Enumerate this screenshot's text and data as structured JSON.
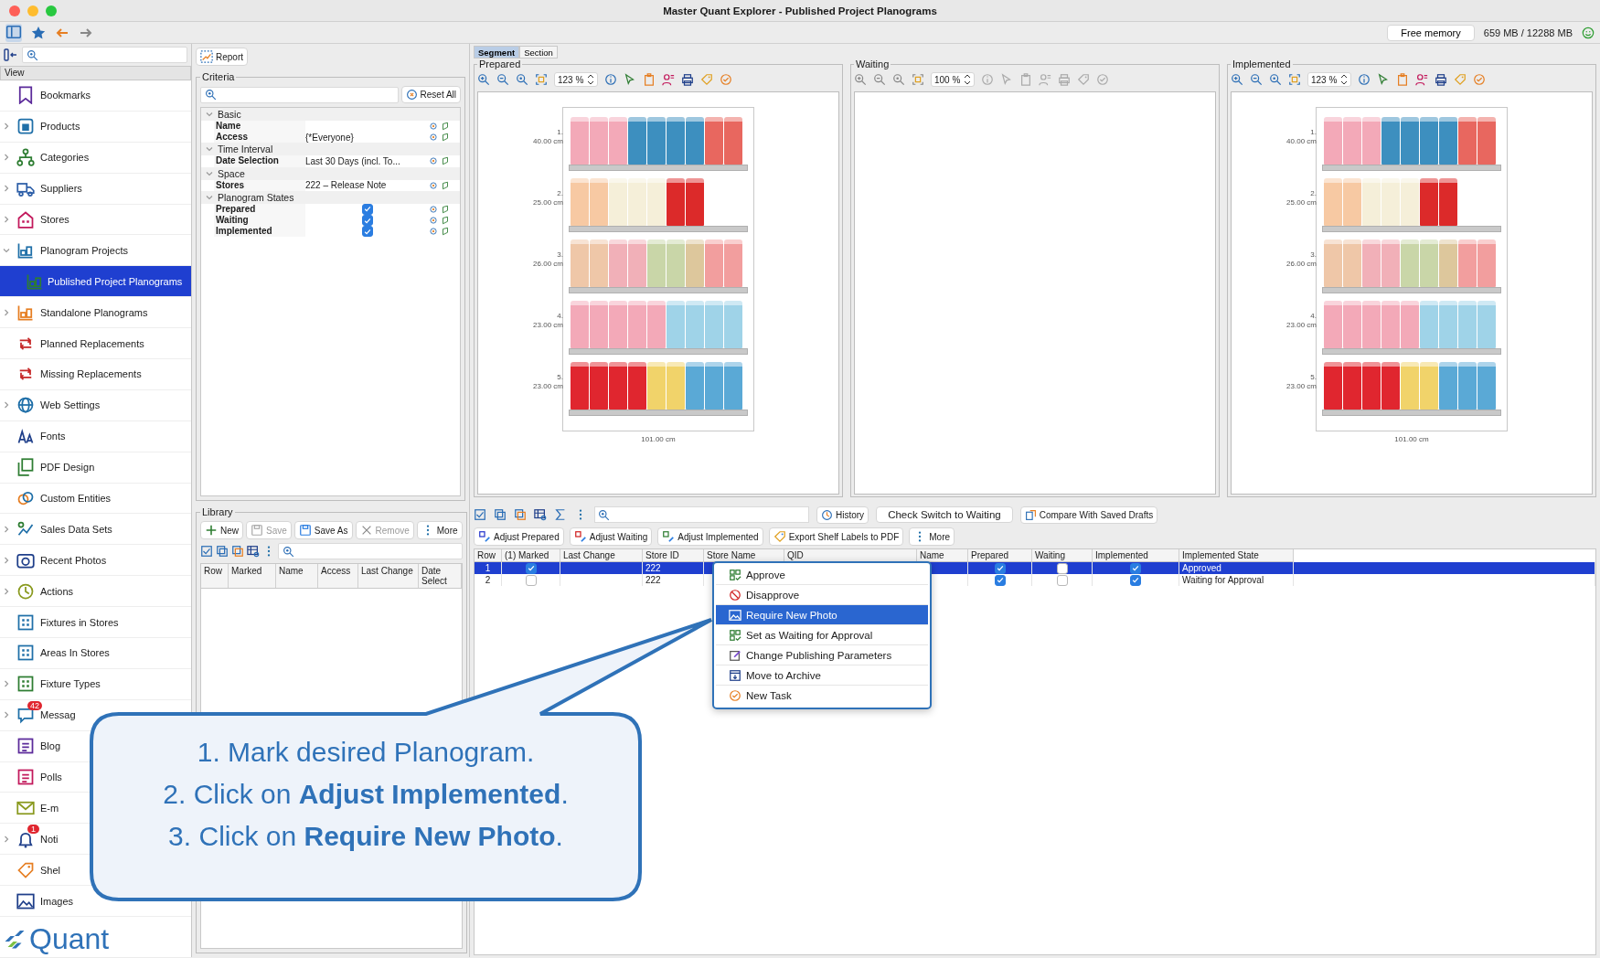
{
  "window": {
    "title": "Master Quant Explorer - Published Project Planograms"
  },
  "toolbar": {
    "free_memory_button": "Free memory",
    "memory_reading": "659 MB / 12288 MB"
  },
  "sidebar": {
    "header": "View",
    "logo": "Quant",
    "items": [
      {
        "label": "Bookmarks",
        "kind": "bookmarks",
        "expandable": false,
        "selected": false
      },
      {
        "label": "Products",
        "kind": "products",
        "expandable": true,
        "expanded": false,
        "selected": false
      },
      {
        "label": "Categories",
        "kind": "categories",
        "expandable": true,
        "expanded": false,
        "selected": false
      },
      {
        "label": "Suppliers",
        "kind": "suppliers",
        "expandable": true,
        "expanded": false,
        "selected": false
      },
      {
        "label": "Stores",
        "kind": "stores",
        "expandable": true,
        "expanded": false,
        "selected": false
      },
      {
        "label": "Planogram Projects",
        "kind": "planogram_projects",
        "expandable": true,
        "expanded": true,
        "selected": false,
        "children": [
          {
            "label": "Published Project Planograms",
            "kind": "published",
            "expandable": false,
            "selected": true
          }
        ]
      },
      {
        "label": "Standalone Planograms",
        "kind": "standalone",
        "expandable": true,
        "expanded": false,
        "selected": false
      },
      {
        "label": "Planned Replacements",
        "kind": "planned_replacements",
        "expandable": false,
        "selected": false
      },
      {
        "label": "Missing Replacements",
        "kind": "missing_replacements",
        "expandable": false,
        "selected": false
      },
      {
        "label": "Web Settings",
        "kind": "web_settings",
        "expandable": true,
        "expanded": false,
        "selected": false
      },
      {
        "label": "Fonts",
        "kind": "fonts",
        "expandable": false,
        "selected": false
      },
      {
        "label": "PDF Design",
        "kind": "pdf_design",
        "expandable": false,
        "selected": false
      },
      {
        "label": "Custom Entities",
        "kind": "custom_entities",
        "expandable": false,
        "selected": false
      },
      {
        "label": "Sales Data Sets",
        "kind": "sales_data_sets",
        "expandable": true,
        "expanded": false,
        "selected": false
      },
      {
        "label": "Recent Photos",
        "kind": "recent_photos",
        "expandable": true,
        "expanded": false,
        "selected": false
      },
      {
        "label": "Actions",
        "kind": "actions",
        "expandable": true,
        "expanded": false,
        "selected": false
      },
      {
        "label": "Fixtures in Stores",
        "kind": "fixtures",
        "expandable": false,
        "selected": false
      },
      {
        "label": "Areas In Stores",
        "kind": "areas",
        "expandable": false,
        "selected": false
      },
      {
        "label": "Fixture Types",
        "kind": "fixture_types",
        "expandable": true,
        "expanded": false,
        "selected": false
      },
      {
        "label": "Messag",
        "kind": "messages",
        "expandable": true,
        "expanded": false,
        "selected": false,
        "badge": "42"
      },
      {
        "label": "Blog",
        "kind": "blog",
        "expandable": false,
        "selected": false
      },
      {
        "label": "Polls",
        "kind": "polls",
        "expandable": false,
        "selected": false
      },
      {
        "label": "E-m",
        "kind": "email",
        "expandable": false,
        "selected": false
      },
      {
        "label": "Noti",
        "kind": "notifications",
        "expandable": true,
        "expanded": false,
        "selected": false,
        "badge": "1"
      },
      {
        "label": "Shel",
        "kind": "shelf_labels",
        "expandable": false,
        "selected": false
      },
      {
        "label": "Images",
        "kind": "images",
        "expandable": false,
        "selected": false
      }
    ]
  },
  "report_button": "Report",
  "criteria": {
    "title": "Criteria",
    "reset_button": "Reset All",
    "groups": [
      {
        "label": "Basic",
        "expanded": true,
        "rows": [
          {
            "label": "Name",
            "kind": "text"
          },
          {
            "label": "Access",
            "kind": "text",
            "value": "{*Everyone}"
          }
        ]
      },
      {
        "label": "Time Interval",
        "expanded": true,
        "rows": [
          {
            "label": "Date Selection",
            "kind": "text",
            "value": "Last 30 Days (incl. To..."
          }
        ]
      },
      {
        "label": "Space",
        "expanded": true,
        "rows": [
          {
            "label": "Stores",
            "kind": "text",
            "value": "222 – Release Note"
          }
        ]
      },
      {
        "label": "Planogram States",
        "expanded": true,
        "rows": [
          {
            "label": "Prepared",
            "kind": "checkbox",
            "checked": true
          },
          {
            "label": "Waiting",
            "kind": "checkbox",
            "checked": true
          },
          {
            "label": "Implemented",
            "kind": "checkbox",
            "checked": true
          }
        ]
      }
    ]
  },
  "library": {
    "title": "Library",
    "buttons": [
      {
        "label": "New",
        "kind": "plus",
        "disabled": false
      },
      {
        "label": "Save",
        "kind": "save",
        "disabled": true
      },
      {
        "label": "Save As",
        "kind": "save",
        "disabled": false
      },
      {
        "label": "Remove",
        "kind": "cross",
        "disabled": true
      },
      {
        "label": "More",
        "kind": "dots",
        "disabled": false
      }
    ],
    "columns": [
      "Row",
      "Marked",
      "Name",
      "Access",
      "Last Change",
      "Date Select"
    ]
  },
  "views": {
    "tabs": [
      {
        "label": "Segment",
        "selected": true
      },
      {
        "label": "Section",
        "selected": false
      }
    ],
    "panels": [
      {
        "title": "Prepared",
        "zoom": "123 %",
        "tools_enabled": true,
        "width_label": "101.00 cm",
        "shelves": [
          {
            "number": "1.",
            "height": "40.00 cm",
            "products": [
              {
                "color": "#f3a9b8"
              },
              {
                "color": "#f3a9b8"
              },
              {
                "color": "#f3a9b8"
              },
              {
                "color": "#3d8fbf"
              },
              {
                "color": "#3d8fbf"
              },
              {
                "color": "#3d8fbf"
              },
              {
                "color": "#3d8fbf"
              },
              {
                "color": "#e8675f"
              },
              {
                "color": "#e8675f"
              }
            ]
          },
          {
            "number": "2.",
            "height": "25.00 cm",
            "products": [
              {
                "color": "#f7c9a3"
              },
              {
                "color": "#f7c9a3"
              },
              {
                "color": "#f5efd9"
              },
              {
                "color": "#f5efd9"
              },
              {
                "color": "#f5efd9"
              },
              {
                "color": "#dc2a2a"
              },
              {
                "color": "#dc2a2a"
              }
            ]
          },
          {
            "number": "3.",
            "height": "26.00 cm",
            "products": [
              {
                "color": "#efc7a8"
              },
              {
                "color": "#efc7a8"
              },
              {
                "color": "#f1b0b8"
              },
              {
                "color": "#f1b0b8"
              },
              {
                "color": "#c9d6a8"
              },
              {
                "color": "#c9d6a8"
              },
              {
                "color": "#ddc79c"
              },
              {
                "color": "#f29e9e"
              },
              {
                "color": "#f29e9e"
              }
            ]
          },
          {
            "number": "4.",
            "height": "23.00 cm",
            "products": [
              {
                "color": "#f3a9b8"
              },
              {
                "color": "#f3a9b8"
              },
              {
                "color": "#f3a9b8"
              },
              {
                "color": "#f3a9b8"
              },
              {
                "color": "#f3a9b8"
              },
              {
                "color": "#9fd3e8"
              },
              {
                "color": "#9fd3e8"
              },
              {
                "color": "#9fd3e8"
              },
              {
                "color": "#9fd3e8"
              }
            ]
          },
          {
            "number": "5.",
            "height": "23.00 cm",
            "products": [
              {
                "color": "#e0262f"
              },
              {
                "color": "#e0262f"
              },
              {
                "color": "#e0262f"
              },
              {
                "color": "#e0262f"
              },
              {
                "color": "#f1d36a"
              },
              {
                "color": "#f1d36a"
              },
              {
                "color": "#5aa9d6"
              },
              {
                "color": "#5aa9d6"
              },
              {
                "color": "#5aa9d6"
              }
            ]
          }
        ]
      },
      {
        "title": "Waiting",
        "zoom": "100 %",
        "tools_enabled": false
      },
      {
        "title": "Implemented",
        "zoom": "123 %",
        "tools_enabled": true,
        "width_label": "101.00 cm",
        "shelves": [
          {
            "number": "1.",
            "height": "40.00 cm",
            "products": [
              {
                "color": "#f3a9b8"
              },
              {
                "color": "#f3a9b8"
              },
              {
                "color": "#f3a9b8"
              },
              {
                "color": "#3d8fbf"
              },
              {
                "color": "#3d8fbf"
              },
              {
                "color": "#3d8fbf"
              },
              {
                "color": "#3d8fbf"
              },
              {
                "color": "#e8675f"
              },
              {
                "color": "#e8675f"
              }
            ]
          },
          {
            "number": "2.",
            "height": "25.00 cm",
            "products": [
              {
                "color": "#f7c9a3"
              },
              {
                "color": "#f7c9a3"
              },
              {
                "color": "#f5efd9"
              },
              {
                "color": "#f5efd9"
              },
              {
                "color": "#f5efd9"
              },
              {
                "color": "#dc2a2a"
              },
              {
                "color": "#dc2a2a"
              }
            ]
          },
          {
            "number": "3.",
            "height": "26.00 cm",
            "products": [
              {
                "color": "#efc7a8"
              },
              {
                "color": "#efc7a8"
              },
              {
                "color": "#f1b0b8"
              },
              {
                "color": "#f1b0b8"
              },
              {
                "color": "#c9d6a8"
              },
              {
                "color": "#c9d6a8"
              },
              {
                "color": "#ddc79c"
              },
              {
                "color": "#f29e9e"
              },
              {
                "color": "#f29e9e"
              }
            ]
          },
          {
            "number": "4.",
            "height": "23.00 cm",
            "products": [
              {
                "color": "#f3a9b8"
              },
              {
                "color": "#f3a9b8"
              },
              {
                "color": "#f3a9b8"
              },
              {
                "color": "#f3a9b8"
              },
              {
                "color": "#f3a9b8"
              },
              {
                "color": "#9fd3e8"
              },
              {
                "color": "#9fd3e8"
              },
              {
                "color": "#9fd3e8"
              },
              {
                "color": "#9fd3e8"
              }
            ]
          },
          {
            "number": "5.",
            "height": "23.00 cm",
            "products": [
              {
                "color": "#e0262f"
              },
              {
                "color": "#e0262f"
              },
              {
                "color": "#e0262f"
              },
              {
                "color": "#e0262f"
              },
              {
                "color": "#f1d36a"
              },
              {
                "color": "#f1d36a"
              },
              {
                "color": "#5aa9d6"
              },
              {
                "color": "#5aa9d6"
              },
              {
                "color": "#5aa9d6"
              }
            ]
          }
        ]
      }
    ]
  },
  "results": {
    "history_button": "History",
    "check_button": "Check Switch to Waiting",
    "compare_button": "Compare With Saved Drafts",
    "actions": [
      {
        "label": "Adjust Prepared",
        "kind": "adjust_blue"
      },
      {
        "label": "Adjust Waiting",
        "kind": "adjust_red"
      },
      {
        "label": "Adjust Implemented",
        "kind": "adjust_green"
      },
      {
        "label": "Export Shelf Labels to PDF",
        "kind": "label"
      },
      {
        "label": "More",
        "kind": "dots"
      }
    ],
    "columns": [
      "Row",
      "(1) Marked",
      "Last Change",
      "Store ID",
      "Store Name",
      "QID",
      "Name",
      "Prepared",
      "Waiting",
      "Implemented",
      "Implemented State"
    ],
    "rows": [
      {
        "selected": true,
        "row": "1",
        "marked": true,
        "store_id": "222",
        "prepared": true,
        "waiting": false,
        "implemented": true,
        "state": "Approved"
      },
      {
        "selected": false,
        "row": "2",
        "marked": false,
        "store_id": "222",
        "prepared": true,
        "waiting": false,
        "implemented": true,
        "state": "Waiting for Approval"
      }
    ]
  },
  "context_menu": {
    "items": [
      {
        "label": "Approve",
        "kind": "approve",
        "selected": false
      },
      {
        "label": "Disapprove",
        "kind": "forbid",
        "selected": false
      },
      {
        "label": "Require New Photo",
        "kind": "photo",
        "selected": true
      },
      {
        "label": "Set as Waiting for Approval",
        "kind": "approve",
        "selected": false
      },
      {
        "label": "Change Publishing Parameters",
        "kind": "edit",
        "selected": false
      },
      {
        "label": "Move to Archive",
        "kind": "archive",
        "selected": false
      },
      {
        "label": "New Task",
        "kind": "task",
        "selected": false
      }
    ]
  },
  "callout": {
    "lines": [
      "1. Mark desired Planogram.",
      "2. Click on **Adjust Implemented**.",
      "3. Click on **Require New Photo**."
    ]
  }
}
